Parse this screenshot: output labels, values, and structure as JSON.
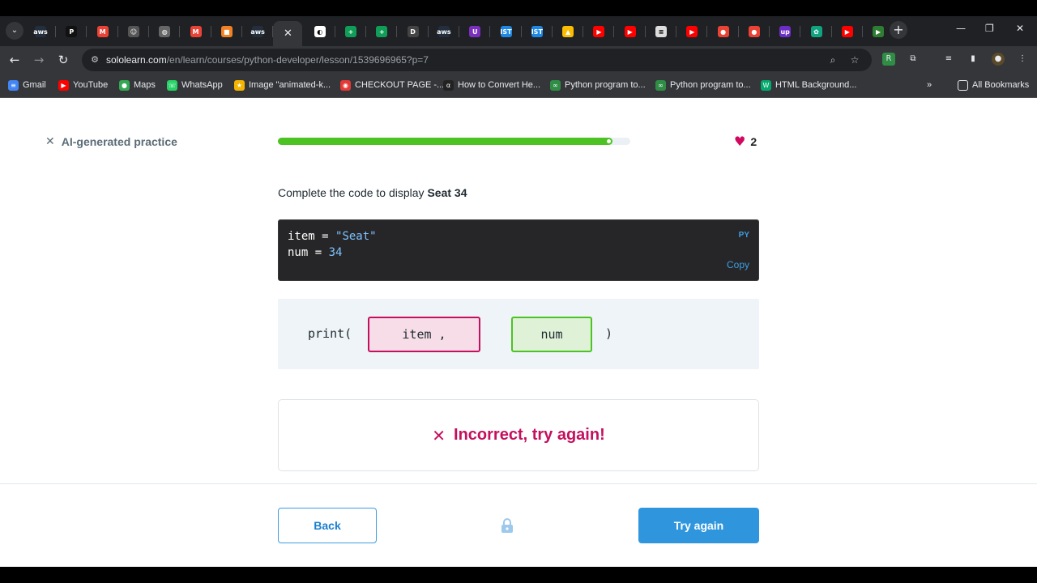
{
  "browser": {
    "tabs": [
      {
        "icon": "aws-icon",
        "glyph": "aws",
        "color": "#232f3e"
      },
      {
        "icon": "p-icon",
        "glyph": "P",
        "color": "#111111"
      },
      {
        "icon": "gmail-icon",
        "glyph": "M",
        "color": "#ea4335"
      },
      {
        "icon": "robot-icon",
        "glyph": "☺",
        "color": "#555555"
      },
      {
        "icon": "globe-icon",
        "glyph": "◍",
        "color": "#666666"
      },
      {
        "icon": "gmail-icon",
        "glyph": "M",
        "color": "#ea4335"
      },
      {
        "icon": "box-icon",
        "glyph": "■",
        "color": "#f48024"
      },
      {
        "icon": "aws-icon",
        "glyph": "aws",
        "color": "#232f3e"
      },
      {
        "icon": "close-icon",
        "glyph": "✕",
        "color": "#35363a",
        "active": true
      },
      {
        "icon": "sololearn-icon",
        "glyph": "◐",
        "color": "#ffffff"
      },
      {
        "icon": "sheets-icon",
        "glyph": "+",
        "color": "#0f9d58"
      },
      {
        "icon": "sheets-icon",
        "glyph": "+",
        "color": "#0f9d58"
      },
      {
        "icon": "d-icon",
        "glyph": "D",
        "color": "#444444"
      },
      {
        "icon": "aws-icon",
        "glyph": "aws",
        "color": "#232f3e"
      },
      {
        "icon": "u-icon",
        "glyph": "U",
        "color": "#7b2fbe"
      },
      {
        "icon": "ist-icon",
        "glyph": "IST",
        "color": "#1e88e5"
      },
      {
        "icon": "ist-icon",
        "glyph": "IST",
        "color": "#1e88e5"
      },
      {
        "icon": "drive-icon",
        "glyph": "▲",
        "color": "#fbbc04"
      },
      {
        "icon": "youtube-icon",
        "glyph": "▶",
        "color": "#ff0000"
      },
      {
        "icon": "youtube-icon",
        "glyph": "▶",
        "color": "#ff0000"
      },
      {
        "icon": "doc-icon",
        "glyph": "≡",
        "color": "#dddddd"
      },
      {
        "icon": "youtube-icon",
        "glyph": "▶",
        "color": "#ff0000"
      },
      {
        "icon": "maps-icon",
        "glyph": "●",
        "color": "#ea4335"
      },
      {
        "icon": "maps-icon",
        "glyph": "●",
        "color": "#ea4335"
      },
      {
        "icon": "upwork-icon",
        "glyph": "up",
        "color": "#6c2dc7"
      },
      {
        "icon": "chatgpt-icon",
        "glyph": "✿",
        "color": "#10a37f"
      },
      {
        "icon": "youtube-icon",
        "glyph": "▶",
        "color": "#ff0000"
      },
      {
        "icon": "play-icon",
        "glyph": "▶",
        "color": "#2e7d32"
      }
    ],
    "url_host": "sololearn.com",
    "url_path": "/en/learn/courses/python-developer/lesson/1539696965?p=7",
    "bookmarks": [
      {
        "label": "Gmail",
        "icon": "gmail-icon",
        "color": "#4285f4",
        "glyph": "≡"
      },
      {
        "label": "YouTube",
        "icon": "youtube-icon",
        "color": "#ff0000",
        "glyph": "▶"
      },
      {
        "label": "Maps",
        "icon": "maps-icon",
        "color": "#34a853",
        "glyph": "●"
      },
      {
        "label": "WhatsApp",
        "icon": "whatsapp-icon",
        "color": "#25d366",
        "glyph": "☏"
      },
      {
        "label": "Image \"animated-k...",
        "icon": "star-icon",
        "color": "#f4b400",
        "glyph": "★"
      },
      {
        "label": "CHECKOUT PAGE -...",
        "icon": "checkout-icon",
        "color": "#e53935",
        "glyph": "◉"
      },
      {
        "label": "How to Convert He...",
        "icon": "alpha-icon",
        "color": "#222222",
        "glyph": "α"
      },
      {
        "label": "Python program to...",
        "icon": "gfg-icon",
        "color": "#2f8d46",
        "glyph": "∞"
      },
      {
        "label": "Python program to...",
        "icon": "gfg-icon",
        "color": "#2f8d46",
        "glyph": "∞"
      },
      {
        "label": "HTML Background...",
        "icon": "w3-icon",
        "color": "#04aa6d",
        "glyph": "W"
      }
    ],
    "all_bookmarks_label": "All Bookmarks"
  },
  "lesson": {
    "close_label": "AI-generated practice",
    "progress": 0.95,
    "hearts": "2",
    "question_prefix": "Complete the code to display ",
    "question_bold": "Seat 34",
    "code": {
      "line1_var": "item = ",
      "line1_str": "\"Seat\"",
      "line2_var": "num = ",
      "line2_num": "34",
      "lang": "PY",
      "copy_label": "Copy"
    },
    "answer": {
      "prefix": "print(",
      "slot_wrong": "item ,",
      "slot_right": "num",
      "suffix": ")"
    },
    "feedback": "Incorrect, try again!",
    "back_label": "Back",
    "try_label": "Try again"
  },
  "colors": {
    "accent_blue": "#2f96de",
    "error": "#c4105e",
    "success": "#4cc322"
  }
}
